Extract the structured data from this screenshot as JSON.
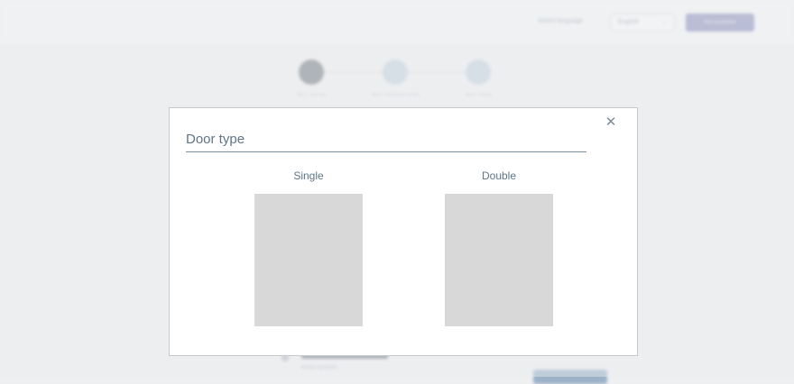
{
  "background": {
    "language_label": "Select language",
    "language_value": "English",
    "header_button": "Get quotation",
    "steps": [
      {
        "label": "Step 1 · Door type"
      },
      {
        "label": "Step 2 · Dimensions & details"
      },
      {
        "label": "Step 3 · Review"
      }
    ],
    "caption": "Answer questions"
  },
  "modal": {
    "title": "Door type",
    "close_icon": "close-icon",
    "options": [
      {
        "label": "Single"
      },
      {
        "label": "Double"
      }
    ]
  },
  "colors": {
    "accent": "#9196bf",
    "title_text": "#5e7586",
    "placeholder_gray": "#d8d8d8"
  }
}
